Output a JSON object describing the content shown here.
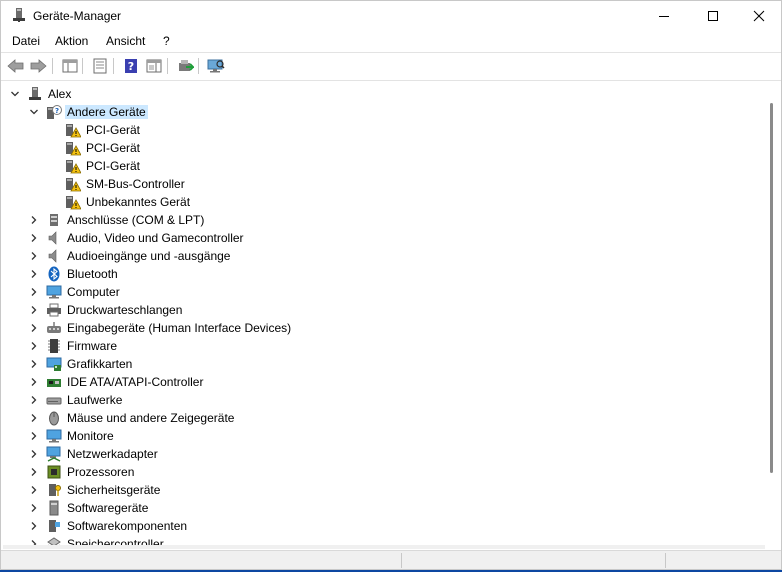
{
  "window": {
    "title": "Geräte-Manager",
    "controls": {
      "minimize": "minimize-icon",
      "maximize": "maximize-icon",
      "close": "close-icon"
    }
  },
  "menu": [
    {
      "label": "Datei"
    },
    {
      "label": "Aktion"
    },
    {
      "label": "Ansicht"
    },
    {
      "label": "?"
    }
  ],
  "toolbar": [
    {
      "icon": "back-arrow-icon"
    },
    {
      "icon": "forward-arrow-icon"
    },
    {
      "icon": "console-tree-icon"
    },
    {
      "icon": "properties-icon"
    },
    {
      "icon": "help-icon"
    },
    {
      "icon": "action-pane-icon"
    },
    {
      "icon": "update-driver-icon"
    },
    {
      "icon": "scan-hardware-icon"
    }
  ],
  "tree": {
    "root": {
      "label": "Alex",
      "icon": "computer-tower-icon",
      "expanded": true
    },
    "other_devices": {
      "label": "Andere Geräte",
      "icon": "unknown-device-icon",
      "expanded": true,
      "selected": true,
      "children": [
        {
          "label": "PCI-Gerät",
          "icon": "warning-device-icon"
        },
        {
          "label": "PCI-Gerät",
          "icon": "warning-device-icon"
        },
        {
          "label": "PCI-Gerät",
          "icon": "warning-device-icon"
        },
        {
          "label": "SM-Bus-Controller",
          "icon": "warning-device-icon"
        },
        {
          "label": "Unbekanntes Gerät",
          "icon": "warning-device-icon"
        }
      ]
    },
    "categories": [
      {
        "label": "Anschlüsse (COM & LPT)",
        "icon": "port-icon"
      },
      {
        "label": "Audio, Video und Gamecontroller",
        "icon": "speaker-icon"
      },
      {
        "label": "Audioeingänge und -ausgänge",
        "icon": "speaker-icon"
      },
      {
        "label": "Bluetooth",
        "icon": "bluetooth-icon"
      },
      {
        "label": "Computer",
        "icon": "monitor-icon"
      },
      {
        "label": "Druckwarteschlangen",
        "icon": "printer-icon"
      },
      {
        "label": "Eingabegeräte (Human Interface Devices)",
        "icon": "hid-icon"
      },
      {
        "label": "Firmware",
        "icon": "chip-icon"
      },
      {
        "label": "Grafikkarten",
        "icon": "display-adapter-icon"
      },
      {
        "label": "IDE ATA/ATAPI-Controller",
        "icon": "ide-controller-icon"
      },
      {
        "label": "Laufwerke",
        "icon": "disk-drive-icon"
      },
      {
        "label": "Mäuse und andere Zeigegeräte",
        "icon": "mouse-icon"
      },
      {
        "label": "Monitore",
        "icon": "monitor-icon"
      },
      {
        "label": "Netzwerkadapter",
        "icon": "network-adapter-icon"
      },
      {
        "label": "Prozessoren",
        "icon": "processor-icon"
      },
      {
        "label": "Sicherheitsgeräte",
        "icon": "security-device-icon"
      },
      {
        "label": "Softwaregeräte",
        "icon": "software-device-icon"
      },
      {
        "label": "Softwarekomponenten",
        "icon": "software-component-icon"
      },
      {
        "label": "Speichercontroller",
        "icon": "storage-controller-icon"
      }
    ]
  }
}
